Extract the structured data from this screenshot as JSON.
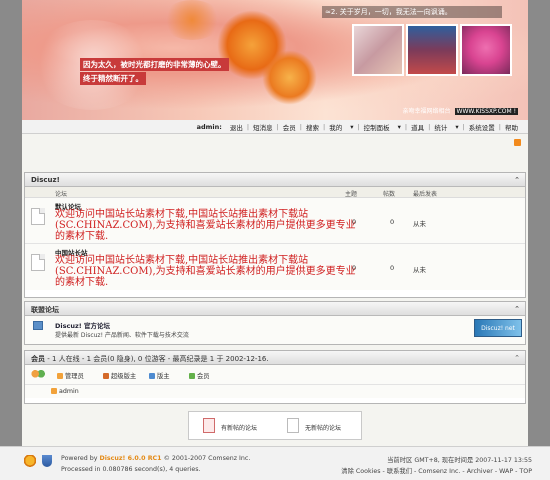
{
  "banner": {
    "motto": "≈2. 关于岁月，一切，我无法一向讽诵。",
    "tagline_1": "因为太久，被时光都打磨的非常薄的心壁。",
    "tagline_2": "终于精然断开了。",
    "footer_text": "亲吻幸福网络相台",
    "url": "WWW.KISSXP.COM !"
  },
  "usernav": {
    "user": "admin:",
    "items": [
      "退出",
      "短消息",
      "会员",
      "搜索",
      "我的",
      "控制面板",
      "道具",
      "统计",
      "系统设置",
      "帮助"
    ]
  },
  "forum_section": {
    "title": "Discuz!",
    "toggle": "⌃",
    "columns": {
      "forum": "论坛",
      "topics": "主题",
      "posts": "帖数",
      "lastpost": "最后发表"
    },
    "forums": [
      {
        "name": "默认论坛",
        "desc": "欢迎访问中国站长站素材下载,中国站长站推出素材下载站(SC.CHINAZ.COM),为支持和喜爱站长素材的用户提供更多更专业的素材下载.",
        "topics": "0",
        "posts": "0",
        "lastpost": "从未"
      },
      {
        "name": "中国站长站",
        "desc": "欢迎访问中国站长站素材下载,中国站长站推出素材下载站(SC.CHINAZ.COM),为支持和喜爱站长素材的用户提供更多更专业的素材下载.",
        "topics": "0",
        "posts": "0",
        "lastpost": "从未"
      }
    ]
  },
  "partners": {
    "title": "联盟论坛",
    "toggle": "⌃",
    "name": "Discuz! 官方论坛",
    "desc": "提供最新 Discuz! 产品新闻、软件下载与技术交流",
    "logo_text": "Discuz! net"
  },
  "members": {
    "label": "会员",
    "stats": " - 1 人在线 - 1 会员(0 隐身), 0 位游客 - 最高纪录是 1 于 2002-12-16.",
    "toggle": "⌃",
    "legend": [
      "管理员",
      "超级版主",
      "版主",
      "会员"
    ],
    "online_user": "admin"
  },
  "legend_box": {
    "new": "有新帖的论坛",
    "none": "无新帖的论坛"
  },
  "footer": {
    "powered_prefix": "Powered by ",
    "brand": "Discuz! 6.0.0 RC1",
    "copyright": " © 2001-2007 Comsenz Inc.",
    "processed": "Processed in 0.080786 second(s), 4 queries.",
    "timezone": "当前时区 GMT+8, 现在时间是 2007-11-17 13:55",
    "links": "清除 Cookies - 联系我们 - Comsenz Inc. - Archiver - WAP - TOP"
  },
  "colors": {
    "accent": "#e48a16",
    "desc_red": "#d02020"
  }
}
